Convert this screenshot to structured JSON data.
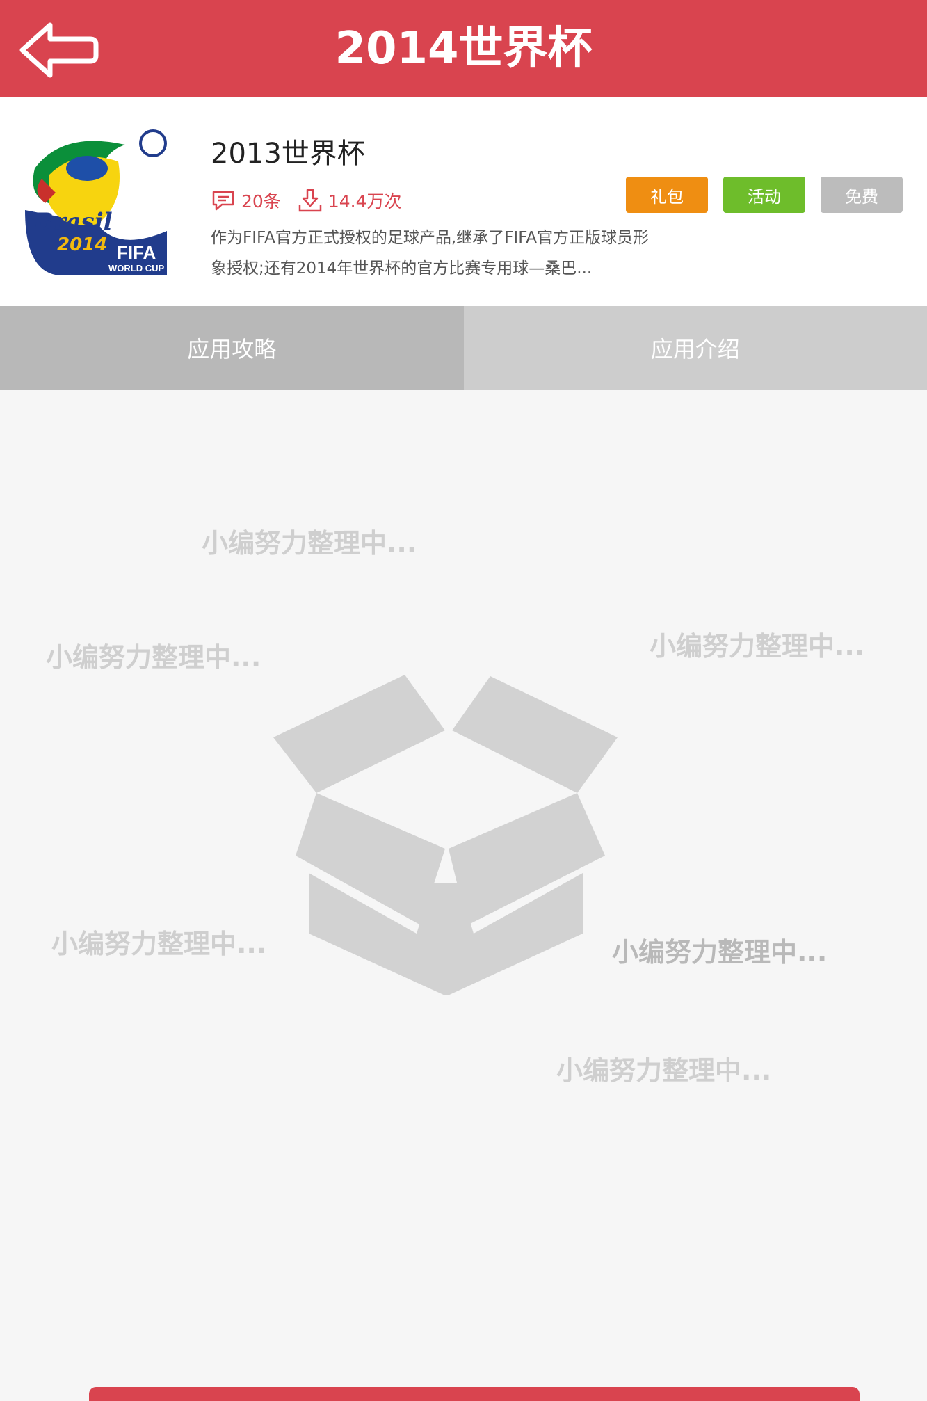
{
  "header": {
    "title": "2014世界杯",
    "back_icon": "back-arrow-icon",
    "color": "#d9444f"
  },
  "app": {
    "name": "2013世界杯",
    "icon": "brasil-2014-fifa-world-cup-logo",
    "comments": "20条",
    "downloads": "14.4万次",
    "tags": {
      "gift": "礼包",
      "activity": "活动",
      "free": "免费"
    },
    "description": "作为FIFA官方正式授权的足球产品,继承了FIFA官方正版球员形象授权;还有2014年世界杯的官方比赛专用球—桑巴..."
  },
  "tabs": {
    "strategy": "应用攻略",
    "intro": "应用介绍",
    "active": "应用攻略"
  },
  "empty_state": {
    "message": "小编努力整理中...",
    "illustration": "open-box-icon"
  }
}
